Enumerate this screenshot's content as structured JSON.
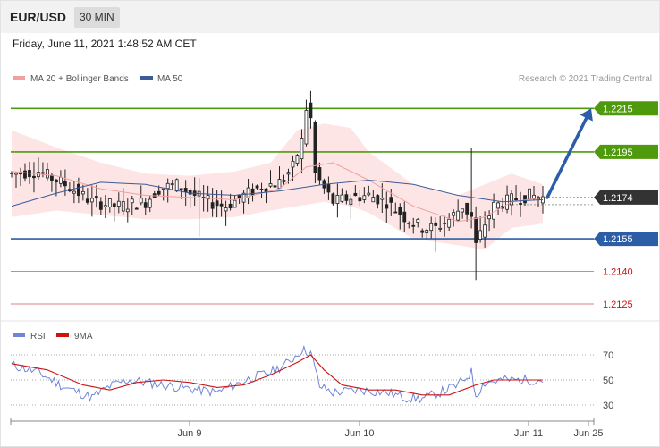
{
  "header": {
    "pair": "EUR/USD",
    "timeframe": "30 MIN",
    "timestamp": "Friday, June 11, 2021 1:48:52 AM CET"
  },
  "legend": {
    "ma20": "MA 20 + Bollinger Bands",
    "ma50": "MA 50",
    "copyright": "Research © 2021 Trading Central",
    "rsi": "RSI",
    "ma9": "9MA"
  },
  "colors": {
    "resistance": "#4f9a0c",
    "support": "#2b5ea7",
    "target": "#d6625f",
    "current": "#333333",
    "candle": "#222222",
    "bollinger": "#fde0e0",
    "ma20": "#f0a0a0",
    "ma50": "#3b5c99",
    "rsi": "#6f85d6",
    "rsi_ma": "#cc1414",
    "arrow": "#2b5ea7"
  },
  "chart_data": [
    {
      "type": "candlestick",
      "ylim": [
        1.2118,
        1.2225
      ],
      "levels": [
        {
          "value": 1.2215,
          "label": "1.2215",
          "kind": "resistance"
        },
        {
          "value": 1.2195,
          "label": "1.2195",
          "kind": "resistance"
        },
        {
          "value": 1.2174,
          "label": "1.2174",
          "kind": "current"
        },
        {
          "value": 1.2155,
          "label": "1.2155",
          "kind": "support"
        },
        {
          "value": 1.214,
          "label": "1.2140",
          "kind": "target"
        },
        {
          "value": 1.2125,
          "label": "1.2125",
          "kind": "target"
        }
      ],
      "x_ticks": [
        "Jun 9",
        "Jun 10",
        "Jun 11",
        "Jun 25"
      ],
      "close_path": [
        [
          0,
          1.2185
        ],
        [
          6,
          1.2186
        ],
        [
          12,
          1.218
        ],
        [
          18,
          1.2172
        ],
        [
          24,
          1.217
        ],
        [
          30,
          1.2172
        ],
        [
          33,
          1.2178
        ],
        [
          37,
          1.218
        ],
        [
          40,
          1.2176
        ],
        [
          44,
          1.2172
        ],
        [
          48,
          1.217
        ],
        [
          52,
          1.2175
        ],
        [
          56,
          1.2179
        ],
        [
          60,
          1.2181
        ],
        [
          63,
          1.2188
        ],
        [
          65,
          1.22
        ],
        [
          66,
          1.2215
        ],
        [
          67,
          1.221
        ],
        [
          68,
          1.2185
        ],
        [
          70,
          1.2178
        ],
        [
          72,
          1.2172
        ],
        [
          76,
          1.2174
        ],
        [
          80,
          1.2175
        ],
        [
          84,
          1.2172
        ],
        [
          88,
          1.2165
        ],
        [
          92,
          1.216
        ],
        [
          95,
          1.216
        ],
        [
          98,
          1.2164
        ],
        [
          101,
          1.217
        ],
        [
          103,
          1.2165
        ],
        [
          104,
          1.2152
        ],
        [
          106,
          1.2162
        ],
        [
          108,
          1.217
        ],
        [
          112,
          1.2173
        ],
        [
          116,
          1.2175
        ],
        [
          119,
          1.2174
        ]
      ],
      "ma20": [
        [
          0,
          1.2186
        ],
        [
          10,
          1.2184
        ],
        [
          20,
          1.2178
        ],
        [
          30,
          1.2175
        ],
        [
          40,
          1.2174
        ],
        [
          50,
          1.2173
        ],
        [
          60,
          1.2178
        ],
        [
          66,
          1.2188
        ],
        [
          72,
          1.219
        ],
        [
          80,
          1.2182
        ],
        [
          90,
          1.217
        ],
        [
          100,
          1.2163
        ],
        [
          106,
          1.2165
        ],
        [
          112,
          1.2172
        ],
        [
          119,
          1.2174
        ]
      ],
      "ma50": [
        [
          0,
          1.217
        ],
        [
          10,
          1.2176
        ],
        [
          20,
          1.2181
        ],
        [
          30,
          1.218
        ],
        [
          40,
          1.2176
        ],
        [
          50,
          1.2175
        ],
        [
          60,
          1.2177
        ],
        [
          70,
          1.218
        ],
        [
          80,
          1.2182
        ],
        [
          90,
          1.218
        ],
        [
          100,
          1.2175
        ],
        [
          110,
          1.2172
        ],
        [
          119,
          1.2173
        ]
      ],
      "bb_upper": [
        [
          0,
          1.2205
        ],
        [
          10,
          1.2197
        ],
        [
          20,
          1.219
        ],
        [
          30,
          1.2185
        ],
        [
          40,
          1.2184
        ],
        [
          50,
          1.2186
        ],
        [
          58,
          1.219
        ],
        [
          64,
          1.2205
        ],
        [
          70,
          1.2208
        ],
        [
          76,
          1.2206
        ],
        [
          80,
          1.2195
        ],
        [
          90,
          1.218
        ],
        [
          100,
          1.2175
        ],
        [
          106,
          1.218
        ],
        [
          112,
          1.2185
        ],
        [
          119,
          1.218
        ]
      ],
      "bb_lower": [
        [
          0,
          1.2165
        ],
        [
          10,
          1.2168
        ],
        [
          20,
          1.2166
        ],
        [
          30,
          1.2164
        ],
        [
          40,
          1.2164
        ],
        [
          50,
          1.2165
        ],
        [
          58,
          1.2168
        ],
        [
          64,
          1.217
        ],
        [
          70,
          1.2172
        ],
        [
          76,
          1.217
        ],
        [
          80,
          1.2167
        ],
        [
          90,
          1.2155
        ],
        [
          100,
          1.2152
        ],
        [
          106,
          1.215
        ],
        [
          112,
          1.216
        ],
        [
          119,
          1.2162
        ]
      ],
      "projection": {
        "from": [
          120,
          1.2174
        ],
        "to": [
          130,
          1.2215
        ]
      }
    },
    {
      "type": "line",
      "ylim": [
        20,
        80
      ],
      "y_ticks": [
        "70",
        "50",
        "30"
      ],
      "y_tick_values": [
        70,
        50,
        30
      ],
      "rsi": [
        [
          0,
          62
        ],
        [
          6,
          56
        ],
        [
          12,
          44
        ],
        [
          18,
          36
        ],
        [
          22,
          45
        ],
        [
          26,
          50
        ],
        [
          30,
          48
        ],
        [
          36,
          45
        ],
        [
          42,
          42
        ],
        [
          46,
          40
        ],
        [
          50,
          46
        ],
        [
          54,
          52
        ],
        [
          58,
          56
        ],
        [
          62,
          64
        ],
        [
          65,
          74
        ],
        [
          67,
          72
        ],
        [
          69,
          45
        ],
        [
          72,
          40
        ],
        [
          78,
          42
        ],
        [
          84,
          40
        ],
        [
          88,
          36
        ],
        [
          92,
          35
        ],
        [
          96,
          40
        ],
        [
          100,
          46
        ],
        [
          103,
          56
        ],
        [
          104,
          38
        ],
        [
          106,
          48
        ],
        [
          110,
          50
        ],
        [
          114,
          50
        ],
        [
          119,
          50
        ]
      ],
      "rsi_ma": [
        [
          0,
          63
        ],
        [
          8,
          58
        ],
        [
          16,
          46
        ],
        [
          22,
          42
        ],
        [
          28,
          48
        ],
        [
          34,
          50
        ],
        [
          40,
          48
        ],
        [
          46,
          44
        ],
        [
          52,
          46
        ],
        [
          58,
          54
        ],
        [
          64,
          64
        ],
        [
          67,
          70
        ],
        [
          70,
          58
        ],
        [
          74,
          46
        ],
        [
          80,
          42
        ],
        [
          86,
          42
        ],
        [
          92,
          38
        ],
        [
          98,
          38
        ],
        [
          104,
          46
        ],
        [
          108,
          50
        ],
        [
          112,
          50
        ],
        [
          119,
          50
        ]
      ]
    }
  ]
}
